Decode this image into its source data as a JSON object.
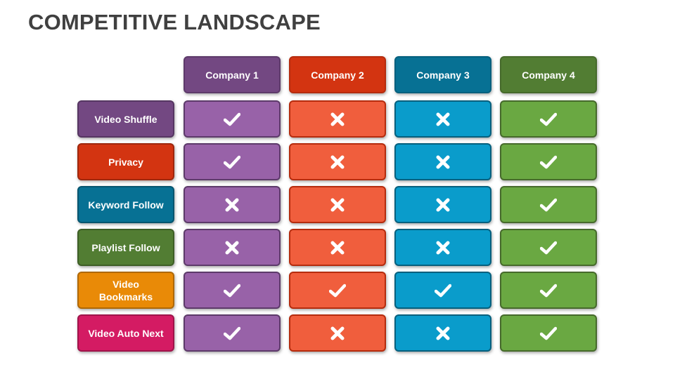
{
  "title": "COMPETITIVE LANDSCAPE",
  "companies": [
    {
      "label": "Company 1",
      "header_color": "#734882",
      "cell_color": "#9862a8",
      "border": "#5d3a6a"
    },
    {
      "label": "Company 2",
      "header_color": "#d33411",
      "cell_color": "#f05e3d",
      "border": "#b52c0e"
    },
    {
      "label": "Company 3",
      "header_color": "#077194",
      "cell_color": "#0a9ccb",
      "border": "#05607e"
    },
    {
      "label": "Company 4",
      "header_color": "#527d33",
      "cell_color": "#6aa842",
      "border": "#466a2b"
    }
  ],
  "features": [
    {
      "label": "Video Shuffle",
      "color": "#734882",
      "values": [
        "check",
        "cross",
        "cross",
        "check"
      ]
    },
    {
      "label": "Privacy",
      "color": "#d33411",
      "values": [
        "check",
        "cross",
        "cross",
        "check"
      ]
    },
    {
      "label": "Keyword Follow",
      "color": "#077194",
      "values": [
        "cross",
        "cross",
        "cross",
        "check"
      ]
    },
    {
      "label": "Playlist Follow",
      "color": "#527d33",
      "values": [
        "cross",
        "cross",
        "cross",
        "check"
      ]
    },
    {
      "label": "Video Bookmarks",
      "color": "#e98a07",
      "values": [
        "check",
        "check",
        "check",
        "check"
      ]
    },
    {
      "label": "Video Auto Next",
      "color": "#d41b63",
      "values": [
        "check",
        "cross",
        "cross",
        "check"
      ]
    }
  ],
  "icons": {
    "check": "check-icon",
    "cross": "cross-icon"
  }
}
